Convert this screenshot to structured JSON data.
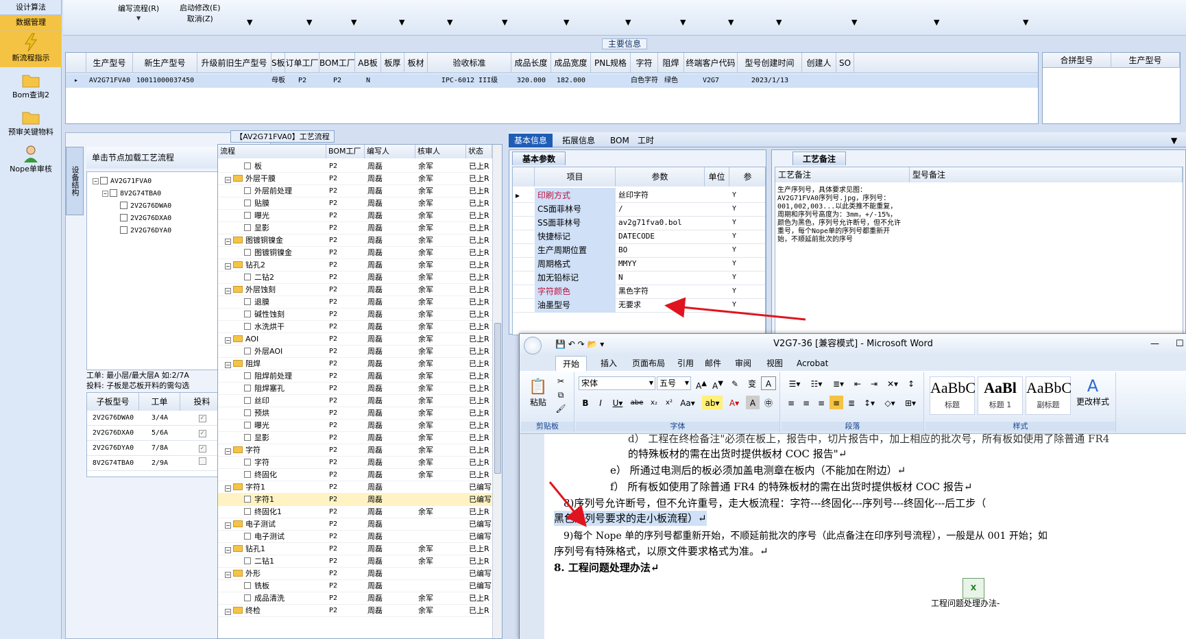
{
  "sidebar": {
    "items": [
      {
        "label": "设计算法",
        "kind": "text"
      },
      {
        "label": "数据管理",
        "kind": "active"
      },
      {
        "label": "新流程指示",
        "kind": "button",
        "icon": "lightning-icon"
      },
      {
        "label": "Bom查询2",
        "kind": "button",
        "icon": "folder-icon"
      },
      {
        "label": "预审关键物料",
        "kind": "button",
        "icon": "folder-icon"
      },
      {
        "label": "Nope单审核",
        "kind": "button",
        "icon": "user-icon"
      }
    ]
  },
  "toolbar": {
    "items": [
      "编写流程(R)",
      "启动修改(E)",
      "取消(Z)"
    ]
  },
  "main": {
    "title": "主要信息",
    "columns": [
      "生产型号",
      "新生产型号",
      "升级前旧生产型号",
      "S板",
      "订单工厂",
      "BOM工厂",
      "AB板",
      "板厚",
      "板材",
      "验收标准",
      "成品长度",
      "成品宽度",
      "PNL规格",
      "字符",
      "阻焊",
      "终端客户代码",
      "型号创建时间",
      "创建人",
      "SO"
    ],
    "row": [
      "AV2G71FVA0",
      "10011000037450",
      "",
      "母板",
      "P2",
      "P2",
      "N",
      "",
      "",
      "IPC-6012 III级",
      "320.000",
      "182.000",
      "",
      "白色字符",
      "绿色",
      "V2G7",
      "2023/1/13",
      "",
      ""
    ],
    "side_columns": [
      "合拼型号",
      "生产型号"
    ]
  },
  "tree_panel": {
    "vtab": "设备结构",
    "header": "单击节点加载工艺流程",
    "nodes": [
      "AV2G71FVA0",
      "8V2G74TBA0",
      "2V2G76DWA0",
      "2V2G76DXA0",
      "2V2G76DYA0"
    ],
    "note_line1": "工单: 最小层/最大层A 如:2/7A",
    "note_line2": "投料: 子板是芯板开料的需勾选",
    "sub_columns": [
      "子板型号",
      "工单",
      "投料"
    ],
    "sub_rows": [
      [
        "2V2G76DWA0",
        "3/4A",
        "✓"
      ],
      [
        "2V2G76DXA0",
        "5/6A",
        "✓"
      ],
      [
        "2V2G76DYA0",
        "7/8A",
        "✓"
      ],
      [
        "8V2G74TBA0",
        "2/9A",
        ""
      ]
    ]
  },
  "process": {
    "title": "【AV2G71FVA0】工艺流程",
    "columns": [
      "流程",
      "BOM工厂",
      "编写人",
      "核审人",
      "状态"
    ],
    "rows": [
      {
        "name": "板",
        "lvl": 2,
        "f": "P2",
        "w": "周磊",
        "r": "余军",
        "s": "已上R"
      },
      {
        "name": "外层干膜",
        "lvl": 1,
        "f": "P2",
        "w": "周磊",
        "r": "余军",
        "s": "已上R"
      },
      {
        "name": "外层前处理",
        "lvl": 2,
        "f": "P2",
        "w": "周磊",
        "r": "余军",
        "s": "已上R"
      },
      {
        "name": "贴膜",
        "lvl": 2,
        "f": "P2",
        "w": "周磊",
        "r": "余军",
        "s": "已上R"
      },
      {
        "name": "曝光",
        "lvl": 2,
        "f": "P2",
        "w": "周磊",
        "r": "余军",
        "s": "已上R"
      },
      {
        "name": "显影",
        "lvl": 2,
        "f": "P2",
        "w": "周磊",
        "r": "余军",
        "s": "已上R"
      },
      {
        "name": "图镀铜镍金",
        "lvl": 1,
        "f": "P2",
        "w": "周磊",
        "r": "余军",
        "s": "已上R"
      },
      {
        "name": "图镀铜镍金",
        "lvl": 2,
        "f": "P2",
        "w": "周磊",
        "r": "余军",
        "s": "已上R"
      },
      {
        "name": "钻孔2",
        "lvl": 1,
        "f": "P2",
        "w": "周磊",
        "r": "余军",
        "s": "已上R"
      },
      {
        "name": "二钻2",
        "lvl": 2,
        "f": "P2",
        "w": "周磊",
        "r": "余军",
        "s": "已上R"
      },
      {
        "name": "外层蚀刻",
        "lvl": 1,
        "f": "P2",
        "w": "周磊",
        "r": "余军",
        "s": "已上R"
      },
      {
        "name": "退膜",
        "lvl": 2,
        "f": "P2",
        "w": "周磊",
        "r": "余军",
        "s": "已上R"
      },
      {
        "name": "碱性蚀刻",
        "lvl": 2,
        "f": "P2",
        "w": "周磊",
        "r": "余军",
        "s": "已上R"
      },
      {
        "name": "水洗烘干",
        "lvl": 2,
        "f": "P2",
        "w": "周磊",
        "r": "余军",
        "s": "已上R"
      },
      {
        "name": "AOI",
        "lvl": 1,
        "f": "P2",
        "w": "周磊",
        "r": "余军",
        "s": "已上R"
      },
      {
        "name": "外层AOI",
        "lvl": 2,
        "f": "P2",
        "w": "周磊",
        "r": "余军",
        "s": "已上R"
      },
      {
        "name": "阻焊",
        "lvl": 1,
        "f": "P2",
        "w": "周磊",
        "r": "余军",
        "s": "已上R"
      },
      {
        "name": "阻焊前处理",
        "lvl": 2,
        "f": "P2",
        "w": "周磊",
        "r": "余军",
        "s": "已上R"
      },
      {
        "name": "阻焊塞孔",
        "lvl": 2,
        "f": "P2",
        "w": "周磊",
        "r": "余军",
        "s": "已上R"
      },
      {
        "name": "丝印",
        "lvl": 2,
        "f": "P2",
        "w": "周磊",
        "r": "余军",
        "s": "已上R"
      },
      {
        "name": "预烘",
        "lvl": 2,
        "f": "P2",
        "w": "周磊",
        "r": "余军",
        "s": "已上R"
      },
      {
        "name": "曝光",
        "lvl": 2,
        "f": "P2",
        "w": "周磊",
        "r": "余军",
        "s": "已上R"
      },
      {
        "name": "显影",
        "lvl": 2,
        "f": "P2",
        "w": "周磊",
        "r": "余军",
        "s": "已上R"
      },
      {
        "name": "字符",
        "lvl": 1,
        "f": "P2",
        "w": "周磊",
        "r": "余军",
        "s": "已上R"
      },
      {
        "name": "字符",
        "lvl": 2,
        "f": "P2",
        "w": "周磊",
        "r": "余军",
        "s": "已上R"
      },
      {
        "name": "终固化",
        "lvl": 2,
        "f": "P2",
        "w": "周磊",
        "r": "余军",
        "s": "已上R"
      },
      {
        "name": "字符1",
        "lvl": 1,
        "f": "P2",
        "w": "周磊",
        "r": "",
        "s": "已编写"
      },
      {
        "name": "字符1",
        "lvl": 2,
        "f": "P2",
        "w": "周磊",
        "r": "",
        "s": "已编写",
        "sel": true
      },
      {
        "name": "终固化1",
        "lvl": 2,
        "f": "P2",
        "w": "周磊",
        "r": "余军",
        "s": "已上R"
      },
      {
        "name": "电子测试",
        "lvl": 1,
        "f": "P2",
        "w": "周磊",
        "r": "",
        "s": "已编写"
      },
      {
        "name": "电子测试",
        "lvl": 2,
        "f": "P2",
        "w": "周磊",
        "r": "",
        "s": "已编写"
      },
      {
        "name": "钻孔1",
        "lvl": 1,
        "f": "P2",
        "w": "周磊",
        "r": "余军",
        "s": "已上R"
      },
      {
        "name": "二钻1",
        "lvl": 2,
        "f": "P2",
        "w": "周磊",
        "r": "余军",
        "s": "已上R"
      },
      {
        "name": "外形",
        "lvl": 1,
        "f": "P2",
        "w": "周磊",
        "r": "",
        "s": "已编写"
      },
      {
        "name": "铣板",
        "lvl": 2,
        "f": "P2",
        "w": "周磊",
        "r": "",
        "s": "已编写"
      },
      {
        "name": "成品清洗",
        "lvl": 2,
        "f": "P2",
        "w": "周磊",
        "r": "余军",
        "s": "已上R"
      },
      {
        "name": "终检",
        "lvl": 1,
        "f": "P2",
        "w": "周磊",
        "r": "余军",
        "s": "已上R"
      }
    ]
  },
  "right": {
    "tabs": [
      "基本信息",
      "拓展信息",
      "BOM",
      "工时"
    ],
    "basic_title": "基本参数",
    "basic_columns": [
      "项目",
      "参数",
      "单位",
      "参"
    ],
    "basic_rows": [
      {
        "k": "印刷方式",
        "v": "丝印字符",
        "u": "",
        "y": "Y",
        "red": true
      },
      {
        "k": "CS面菲林号",
        "v": "/",
        "u": "",
        "y": "Y"
      },
      {
        "k": "SS面菲林号",
        "v": "av2g71fva0.bol",
        "u": "",
        "y": "Y"
      },
      {
        "k": "快捷标记",
        "v": "DATECODE",
        "u": "",
        "y": "Y"
      },
      {
        "k": "生产周期位置",
        "v": "BO",
        "u": "",
        "y": "Y"
      },
      {
        "k": "周期格式",
        "v": "MMYY",
        "u": "",
        "y": "Y"
      },
      {
        "k": "加无铅标记",
        "v": "N",
        "u": "",
        "y": "Y"
      },
      {
        "k": "字符颜色",
        "v": "黑色字符",
        "u": "",
        "y": "Y",
        "red": true
      },
      {
        "k": "油墨型号",
        "v": "无要求",
        "u": "",
        "y": "Y"
      }
    ],
    "remark_title": "工艺备注",
    "remark_columns": [
      "工艺备注",
      "型号备注"
    ],
    "remark_text": "生产序列号，具体要求见图：AV2G71FVA0序列号.jpg，序列号：001,002,003...以此类推不能重复，周期和序列号高度为：3mm，+/-15%，颜色为黑色，序列号允许断号，但不允许重号，每个Nope单的序列号都重新开始，不顺延前批次的序号"
  },
  "word": {
    "title": "V2G7-36 [兼容模式] - Microsoft Word",
    "tabs": [
      "开始",
      "插入",
      "页面布局",
      "引用",
      "邮件",
      "审阅",
      "视图",
      "Acrobat"
    ],
    "font_name": "宋体",
    "font_size": "五号",
    "groups": [
      "剪贴板",
      "字体",
      "段落",
      "样式"
    ],
    "paste_label": "粘贴",
    "styles": [
      {
        "preview": "AaBbC",
        "label": "标题"
      },
      {
        "preview": "AaBl",
        "label": "标题 1"
      },
      {
        "preview": "AaBbC",
        "label": "副标题"
      }
    ],
    "change_styles": "更改样式",
    "lines": [
      "d） 工程在终检备注\"必须在板上，报告中，切片报告中，加上相应的批次号，所有板如使用了除普通 FR4",
      "的特殊板材的需在出货时提供板材 COC 报告\"↵",
      "e） 所通过电测后的板必须加盖电测章在板内（不能加在附边）↵",
      "f） 所有板如使用了除普通 FR4 的特殊板材的需在出货时提供板材 COC 报告↵",
      "8)序列号允许断号，但不允许重号，走大板流程：字符---终固化---序列号---终固化---后工步（",
      "黑色序列号要求的走小板流程）↵",
      "9)每个 Nope 单的序列号都重新开始，不顺延前批次的序号（此点备注在印序列号流程），一般是从 001 开始；如",
      "序列号有特殊格式，以原文件要求格式为准。↵",
      "8. 工程问题处理办法↵"
    ],
    "attachment_label": "工程问题处理办法-"
  },
  "colors": {
    "accent": "#1f5cb5",
    "active": "#f5c343",
    "annotation_arrow": "#e0141e"
  }
}
